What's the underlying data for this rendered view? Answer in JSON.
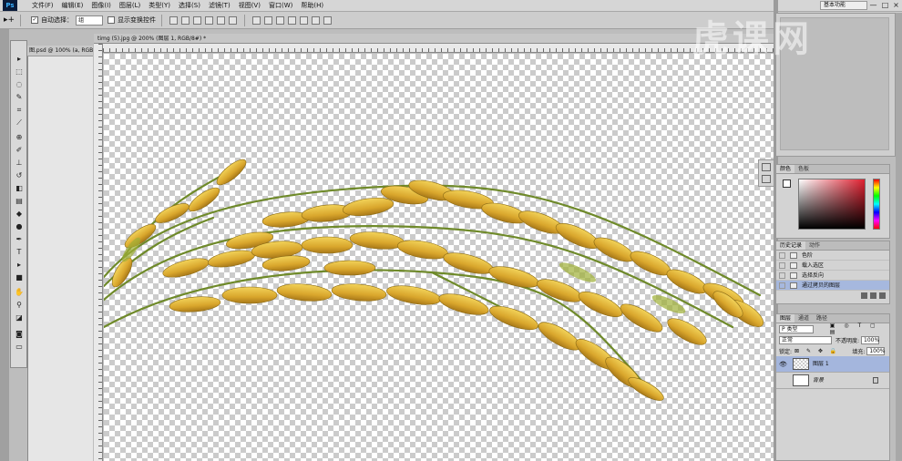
{
  "app": {
    "logo": "Ps"
  },
  "menu": [
    "文件(F)",
    "编辑(E)",
    "图像(I)",
    "图层(L)",
    "类型(Y)",
    "选择(S)",
    "滤镜(T)",
    "视图(V)",
    "窗口(W)",
    "帮助(H)"
  ],
  "workspace": "基本功能",
  "window_controls": [
    "—",
    "□",
    "×"
  ],
  "options": {
    "auto_select_label": "自动选择：",
    "auto_select_value": "组",
    "show_transform_label": "显示变换控件"
  },
  "inactive_doc": {
    "tab": "图.psd @ 100% (a, RGB/8)"
  },
  "document": {
    "tab": "timg (5).jpg @ 200% (图层 1, RGB/8#) *"
  },
  "panels": {
    "color": {
      "tabs": [
        "颜色",
        "色板"
      ]
    },
    "history": {
      "tabs": [
        "历史记录",
        "动作"
      ],
      "items": [
        "色阶",
        "载入选区",
        "选择反向",
        "通过拷贝的图层"
      ]
    },
    "layers": {
      "tabs": [
        "图层",
        "通道",
        "路径"
      ],
      "kind": "P 类型",
      "blend_mode": "正常",
      "opacity_label": "不透明度:",
      "opacity": "100%",
      "lock_label": "锁定:",
      "fill_label": "填充:",
      "fill": "100%",
      "items": [
        {
          "name": "图层 1",
          "selected": true
        },
        {
          "name": "背景",
          "selected": false
        }
      ]
    }
  },
  "watermark": "虎课网"
}
